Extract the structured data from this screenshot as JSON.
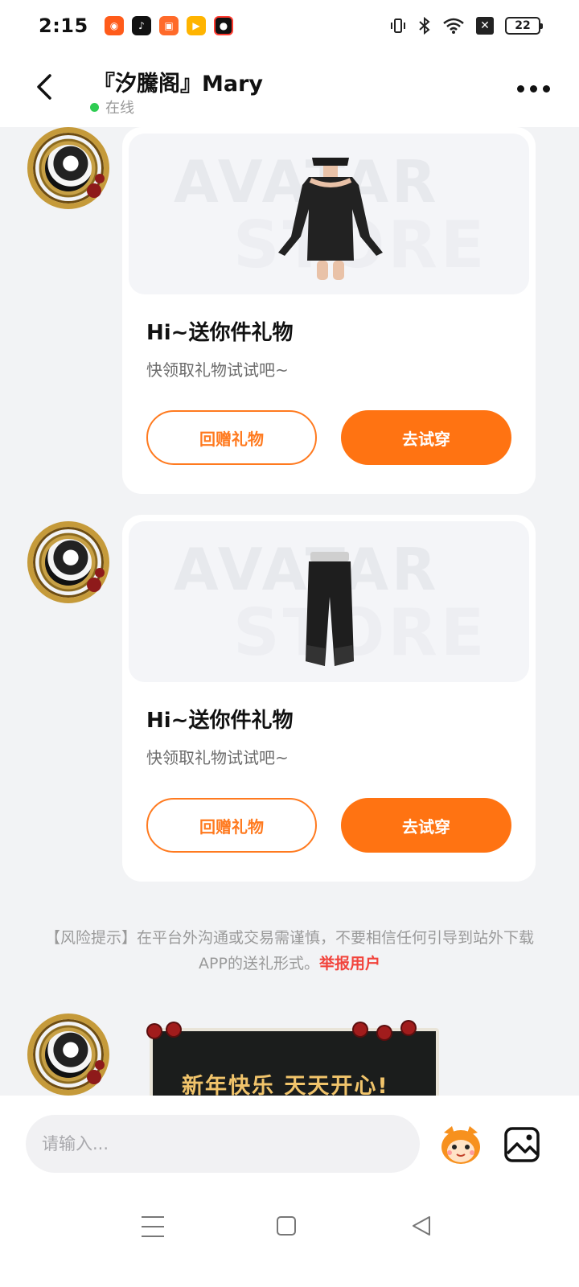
{
  "status_bar": {
    "time": "2:15",
    "battery": "22",
    "apps": [
      "kuaishou-app-icon",
      "tiktok-app-icon",
      "game-app-icon",
      "video-app-icon",
      "screen-record-icon"
    ]
  },
  "header": {
    "title": "『汐騰阁』Mary",
    "status": "在线"
  },
  "messages": [
    {
      "type": "gift",
      "title": "Hi~送你件礼物",
      "subtitle": "快领取礼物试试吧~",
      "btn_return": "回赠礼物",
      "btn_try": "去试穿",
      "item": "black-dress"
    },
    {
      "type": "gift",
      "title": "Hi~送你件礼物",
      "subtitle": "快领取礼物试试吧~",
      "btn_return": "回赠礼物",
      "btn_try": "去试穿",
      "item": "black-pants"
    }
  ],
  "risk_notice": {
    "text": "【风险提示】在平台外沟通或交易需谨慎，不要相信任何引导到站外下载APP的送礼形式。",
    "report_link": "举报用户"
  },
  "greeting_card": {
    "text": "新年快乐 天天开心!"
  },
  "input": {
    "placeholder": "请输入..."
  },
  "colors": {
    "accent": "#ff7312",
    "report": "#f2433b",
    "online": "#2ecc52"
  }
}
